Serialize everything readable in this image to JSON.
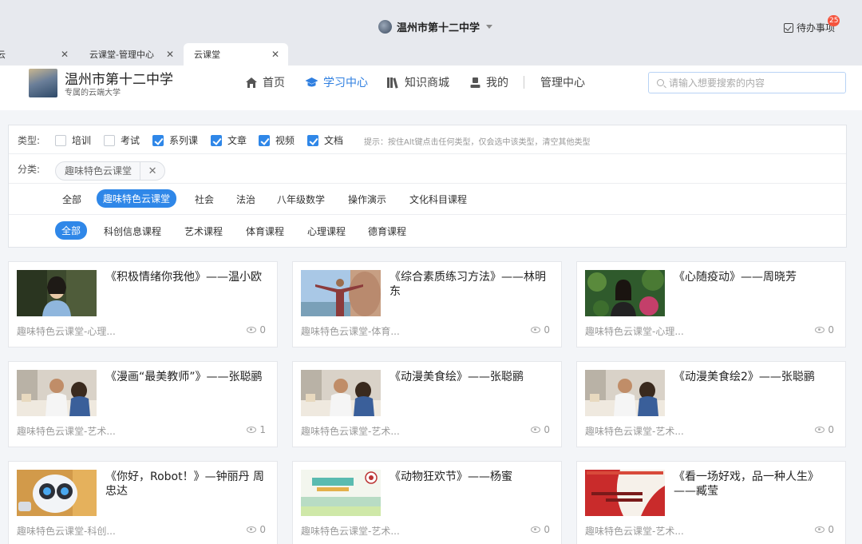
{
  "titlebar": {
    "school": "温州市第十二中学",
    "todo_label": "待办事项",
    "todo_count": "25"
  },
  "tabs": [
    {
      "label": "云",
      "close": "✕"
    },
    {
      "label": "云课堂-管理中心",
      "close": "✕"
    },
    {
      "label": "云课堂",
      "close": "✕"
    }
  ],
  "header": {
    "school_name": "温州市第十二中学",
    "slogan": "专属的云端大学",
    "nav": [
      {
        "label": "首页",
        "icon": "home-icon"
      },
      {
        "label": "学习中心",
        "icon": "graduation-cap-icon"
      },
      {
        "label": "知识商城",
        "icon": "books-icon"
      },
      {
        "label": "我的",
        "icon": "user-icon"
      },
      {
        "label": "管理中心",
        "icon": ""
      }
    ],
    "search_placeholder": "请输入想要搜索的内容"
  },
  "filter": {
    "type_label": "类型:",
    "types": [
      {
        "label": "培训",
        "checked": false
      },
      {
        "label": "考试",
        "checked": false
      },
      {
        "label": "系列课",
        "checked": true
      },
      {
        "label": "文章",
        "checked": true
      },
      {
        "label": "视频",
        "checked": true
      },
      {
        "label": "文档",
        "checked": true
      }
    ],
    "hint": "提示：按住Alt键点击任何类型，仅会选中该类型，清空其他类型",
    "category_label": "分类:",
    "selected_tag": "趣味特色云课堂",
    "tag_close": "✕",
    "level1": [
      "全部",
      "趣味特色云课堂",
      "社会",
      "法治",
      "八年级数学",
      "操作演示",
      "文化科目课程"
    ],
    "level1_active": 1,
    "level2": [
      "全部",
      "科创信息课程",
      "艺术课程",
      "体育课程",
      "心理课程",
      "德育课程"
    ],
    "level2_active": 0
  },
  "cards": [
    {
      "title": "《积极情绪你我他》——温小欧",
      "category": "趣味特色云课堂-心理...",
      "views": "0",
      "thumb": "portrait-woman"
    },
    {
      "title": "《综合素质练习方法》——林明东",
      "category": "趣味特色云课堂-体育...",
      "views": "0",
      "thumb": "outdoor-man"
    },
    {
      "title": "《心随疫动》——周晓芳",
      "category": "趣味特色云课堂-心理...",
      "views": "0",
      "thumb": "portrait-garden"
    },
    {
      "title": "《漫画“最美教师”》——张聪鹂",
      "category": "趣味特色云课堂-艺术...",
      "views": "1",
      "thumb": "classroom-drawing"
    },
    {
      "title": "《动漫美食绘》——张聪鹂",
      "category": "趣味特色云课堂-艺术...",
      "views": "0",
      "thumb": "classroom-drawing"
    },
    {
      "title": "《动漫美食绘2》——张聪鹂",
      "category": "趣味特色云课堂-艺术...",
      "views": "0",
      "thumb": "classroom-drawing"
    },
    {
      "title": "《你好，Robot！》—钟丽丹 周忠达",
      "category": "趣味特色云课堂-科创...",
      "views": "0",
      "thumb": "robot-cartoon"
    },
    {
      "title": "《动物狂欢节》——杨蜜",
      "category": "趣味特色云课堂-艺术...",
      "views": "0",
      "thumb": "poster-green"
    },
    {
      "title": "《看一场好戏，品一种人生》——臧莹",
      "category": "趣味特色云课堂-艺术...",
      "views": "0",
      "thumb": "poster-red"
    }
  ]
}
